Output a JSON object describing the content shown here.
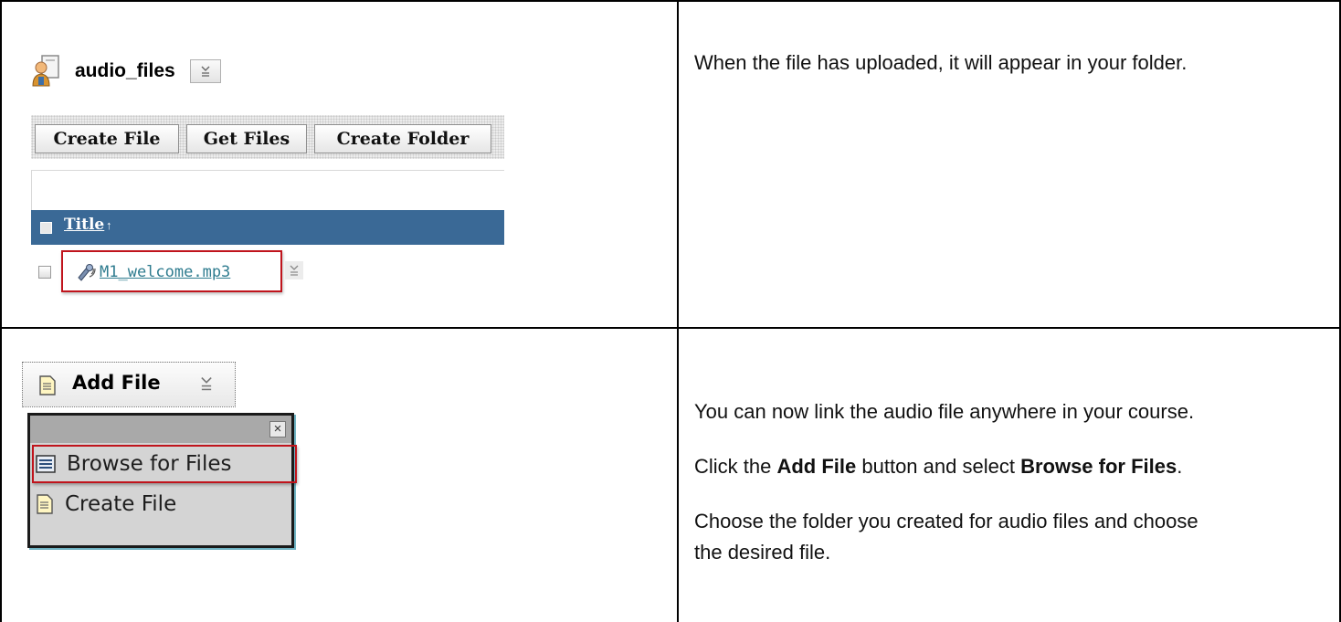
{
  "top_left": {
    "folder_name": "audio_files",
    "toolbar_buttons": [
      "Create File",
      "Get Files",
      "Create Folder"
    ],
    "list_header_title": "Title",
    "file_name": "M1_welcome.mp3"
  },
  "top_right": {
    "text": "When the file has uploaded, it will appear in your folder."
  },
  "bottom_left": {
    "add_file_label": "Add File",
    "menu_items": [
      "Browse for Files",
      "Create File"
    ]
  },
  "bottom_right": {
    "line1": "You can now link the audio file anywhere in your course.",
    "line2_prefix": "Click the ",
    "line2_bold1": "Add File",
    "line2_mid": " button and select ",
    "line2_bold2": "Browse for Files",
    "line2_suffix": ".",
    "line3": "Choose the folder you created for audio files and choose",
    "line4": "the desired file."
  },
  "colors": {
    "list_header": "#3a6996",
    "highlight": "#c0141c",
    "link": "#2f7c8f"
  }
}
